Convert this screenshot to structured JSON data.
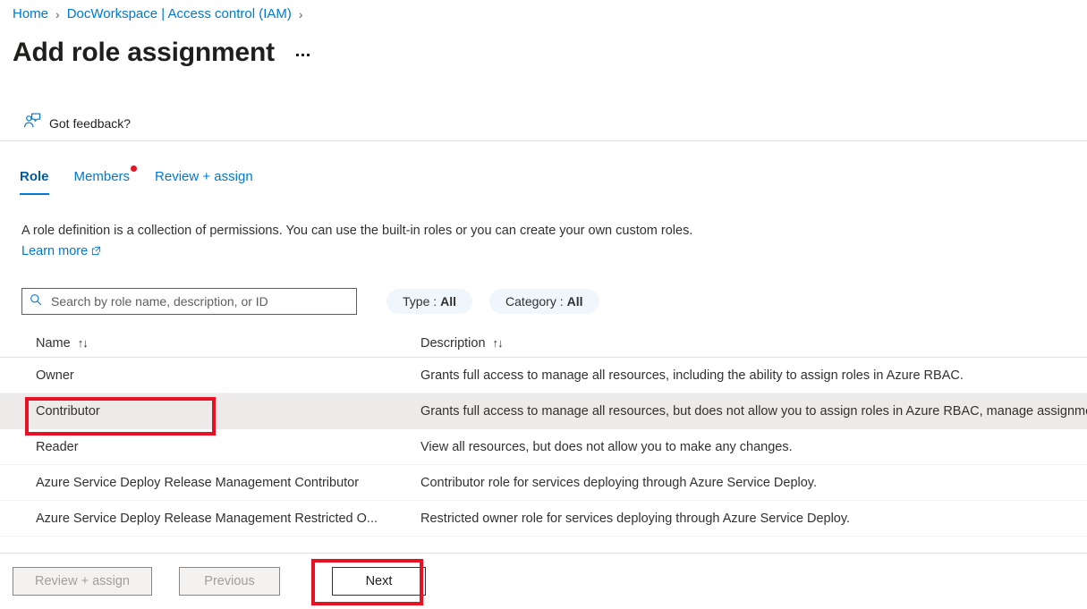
{
  "breadcrumb": {
    "items": [
      {
        "label": "Home"
      },
      {
        "label": "DocWorkspace | Access control (IAM)"
      }
    ],
    "separator": "›"
  },
  "header": {
    "title": "Add role assignment",
    "more_menu": "…"
  },
  "command_bar": {
    "feedback_label": "Got feedback?",
    "feedback_icon": "person-feedback-icon"
  },
  "tabs": [
    {
      "label": "Role",
      "active": true,
      "badge": false
    },
    {
      "label": "Members",
      "active": false,
      "badge": true
    },
    {
      "label": "Review + assign",
      "active": false,
      "badge": false
    }
  ],
  "description": {
    "text": "A role definition is a collection of permissions. You can use the built-in roles or you can create your own custom roles. ",
    "link_label": "Learn more",
    "link_icon": "external-link-icon"
  },
  "search": {
    "placeholder": "Search by role name, description, or ID",
    "value": "",
    "icon": "search-icon"
  },
  "filters": [
    {
      "label": "Type :",
      "value": "All"
    },
    {
      "label": "Category :",
      "value": "All"
    }
  ],
  "table": {
    "columns": [
      {
        "label": "Name",
        "sort_icon": "↑↓"
      },
      {
        "label": "Description",
        "sort_icon": "↑↓"
      }
    ],
    "rows": [
      {
        "name": "Owner",
        "description": "Grants full access to manage all resources, including the ability to assign roles in Azure RBAC.",
        "selected": false
      },
      {
        "name": "Contributor",
        "description": "Grants full access to manage all resources, but does not allow you to assign roles in Azure RBAC, manage assignments in Azure Blueprints, or share image galleries.",
        "selected": true
      },
      {
        "name": "Reader",
        "description": "View all resources, but does not allow you to make any changes.",
        "selected": false
      },
      {
        "name": "Azure Service Deploy Release Management Contributor",
        "description": "Contributor role for services deploying through Azure Service Deploy.",
        "selected": false
      },
      {
        "name": "Azure Service Deploy Release Management Restricted O...",
        "description": "Restricted owner role for services deploying through Azure Service Deploy.",
        "selected": false
      }
    ]
  },
  "footer": {
    "review_assign_label": "Review + assign",
    "previous_label": "Previous",
    "next_label": "Next"
  },
  "annotations": {
    "highlight_color": "#e81123",
    "targets": [
      "contributor-row-name",
      "next-button"
    ]
  },
  "colors": {
    "accent": "#0078d4",
    "accent_dark": "#005a9e",
    "badge_red": "#e81123",
    "row_selected": "#edebe9",
    "pill_bg": "#eff6fc"
  }
}
